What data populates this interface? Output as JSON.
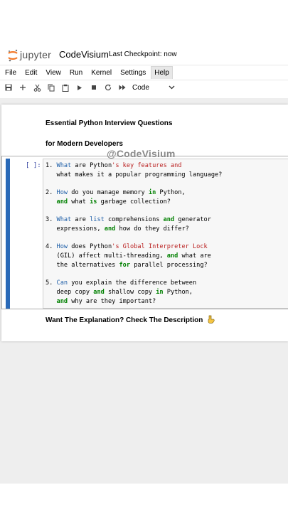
{
  "header": {
    "logo_text": "jupyter",
    "notebook_name": "CodeVisium",
    "checkpoint": "Last Checkpoint: now"
  },
  "menu": {
    "items": [
      "File",
      "Edit",
      "View",
      "Run",
      "Kernel",
      "Settings",
      "Help"
    ],
    "active": "Help"
  },
  "toolbar": {
    "icons": [
      "save-icon",
      "add-icon",
      "cut-icon",
      "copy-icon",
      "paste-icon",
      "run-icon",
      "stop-icon",
      "restart-icon",
      "fast-forward-icon"
    ],
    "cell_type": "Code"
  },
  "notebook": {
    "heading_line1": "Essential Python Interview Questions",
    "heading_line2": "for Modern Developers",
    "watermark": "@CodeVisium",
    "prompt": "[ ]:",
    "code_lines": [
      [
        {
          "t": "1. "
        },
        {
          "t": "What",
          "c": "blue"
        },
        {
          "t": " are Python"
        },
        {
          "t": "'s key features and",
          "c": "str"
        }
      ],
      [
        {
          "t": "   what makes it a popular programming language?"
        }
      ],
      [
        {
          "t": ""
        }
      ],
      [
        {
          "t": "2. "
        },
        {
          "t": "How",
          "c": "blue"
        },
        {
          "t": " do you manage memory "
        },
        {
          "t": "in",
          "c": "kw"
        },
        {
          "t": " Python,"
        }
      ],
      [
        {
          "t": "   "
        },
        {
          "t": "and",
          "c": "kw"
        },
        {
          "t": " what "
        },
        {
          "t": "is",
          "c": "kw"
        },
        {
          "t": " garbage collection?"
        }
      ],
      [
        {
          "t": ""
        }
      ],
      [
        {
          "t": "3. "
        },
        {
          "t": "What",
          "c": "blue"
        },
        {
          "t": " are "
        },
        {
          "t": "list",
          "c": "blue"
        },
        {
          "t": " comprehensions "
        },
        {
          "t": "and",
          "c": "kw"
        },
        {
          "t": " generator"
        }
      ],
      [
        {
          "t": "   expressions, "
        },
        {
          "t": "and",
          "c": "kw"
        },
        {
          "t": " how do they differ?"
        }
      ],
      [
        {
          "t": ""
        }
      ],
      [
        {
          "t": "4. "
        },
        {
          "t": "How",
          "c": "blue"
        },
        {
          "t": " does Python"
        },
        {
          "t": "'s Global Interpreter Lock",
          "c": "str"
        }
      ],
      [
        {
          "t": "   (GIL) affect multi-threading, "
        },
        {
          "t": "and",
          "c": "kw"
        },
        {
          "t": " what are"
        }
      ],
      [
        {
          "t": "   the alternatives "
        },
        {
          "t": "for",
          "c": "kw"
        },
        {
          "t": " parallel processing?"
        }
      ],
      [
        {
          "t": ""
        }
      ],
      [
        {
          "t": "5. "
        },
        {
          "t": "Can",
          "c": "blue"
        },
        {
          "t": " you explain the difference between"
        }
      ],
      [
        {
          "t": "   deep copy "
        },
        {
          "t": "and",
          "c": "kw"
        },
        {
          "t": " shallow copy "
        },
        {
          "t": "in",
          "c": "kw"
        },
        {
          "t": " Python,"
        }
      ],
      [
        {
          "t": "   "
        },
        {
          "t": "and",
          "c": "kw"
        },
        {
          "t": " why are they important?"
        }
      ]
    ],
    "footer": "Want The Explanation? Check The Description"
  },
  "colors": {
    "keyword": "#008000",
    "builtin": "#1f5fa8",
    "string": "#ba2121",
    "cell_selection_bar": "#2a6ab8",
    "notebook_bg": "#eeeeee"
  }
}
